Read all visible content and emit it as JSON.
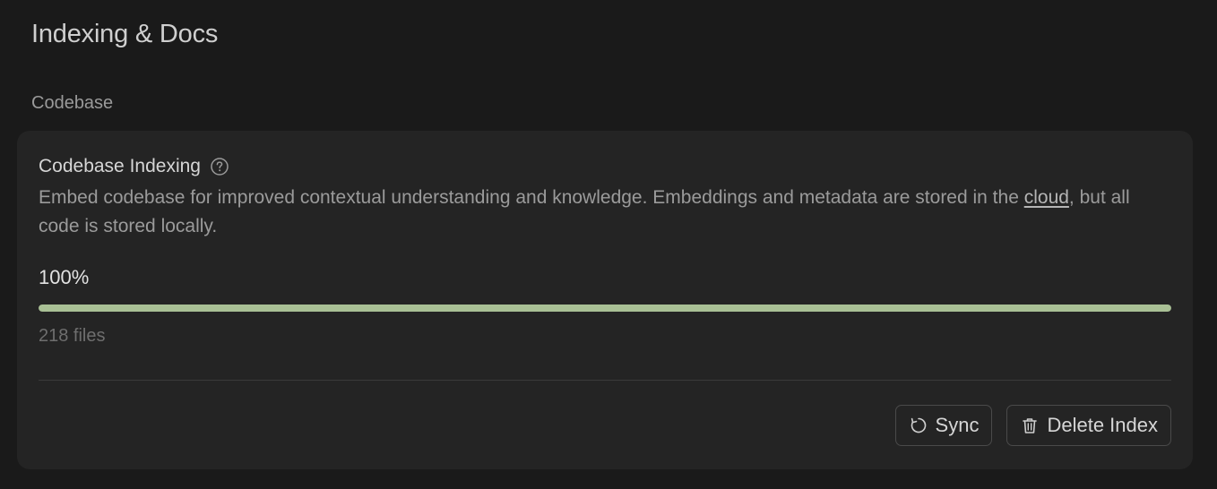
{
  "page": {
    "title": "Indexing & Docs"
  },
  "codebase_section": {
    "label": "Codebase",
    "card": {
      "title": "Codebase Indexing",
      "help_icon": "question-circle-icon",
      "description_before_link": "Embed codebase for improved contextual understanding and knowledge. Embeddings and metadata are stored in the ",
      "description_link": "cloud",
      "description_after_link": ", but all code is stored locally.",
      "progress_text": "100%",
      "progress_fraction": 1.0,
      "file_count": "218 files",
      "sync_button": {
        "label": "Sync",
        "icon": "refresh-icon"
      },
      "delete_button": {
        "label": "Delete Index",
        "icon": "trash-icon"
      }
    }
  },
  "colors": {
    "background": "#1a1a1a",
    "card": "#242424",
    "progress_fill": "#a9c095"
  }
}
